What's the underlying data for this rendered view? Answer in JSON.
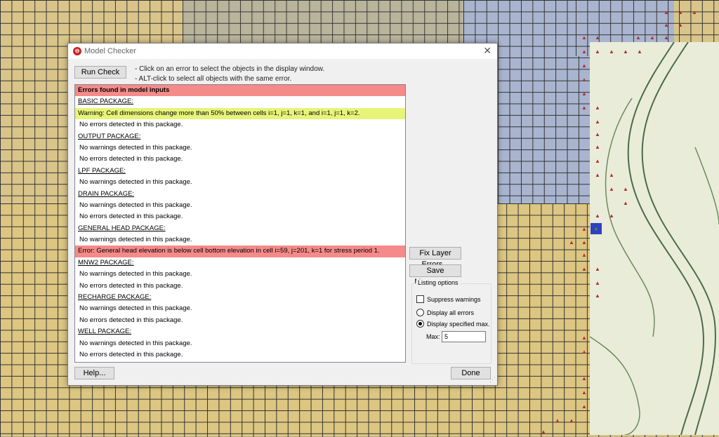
{
  "window": {
    "title": "Model Checker"
  },
  "buttons": {
    "run_check": "Run Check",
    "fix_layer_errors": "Fix Layer Errors...",
    "save_messages": "Save Messages...",
    "help": "Help...",
    "done": "Done"
  },
  "hints": [
    "- Click on an error to select the objects in the display window.",
    "- ALT-click to select all objects with the same error."
  ],
  "messages": [
    {
      "type": "header",
      "text": "Errors found in model inputs"
    },
    {
      "type": "package",
      "text": "BASIC PACKAGE:"
    },
    {
      "type": "warning",
      "text": "Warning:  Cell dimensions change more than 50% between cells i=1, j=1, k=1, and i=1, j=1, k=2."
    },
    {
      "type": "note",
      "text": "No errors detected in this package."
    },
    {
      "type": "package",
      "text": "OUTPUT PACKAGE:"
    },
    {
      "type": "note",
      "text": "No warnings detected in this package."
    },
    {
      "type": "note",
      "text": "No errors detected in this package."
    },
    {
      "type": "package",
      "text": "LPF PACKAGE:"
    },
    {
      "type": "note",
      "text": "No warnings detected in this package."
    },
    {
      "type": "package",
      "text": "DRAIN PACKAGE:"
    },
    {
      "type": "note",
      "text": "No warnings detected in this package."
    },
    {
      "type": "note",
      "text": "No errors detected in this package."
    },
    {
      "type": "package",
      "text": "GENERAL HEAD PACKAGE:"
    },
    {
      "type": "note",
      "text": "No warnings detected in this package."
    },
    {
      "type": "error",
      "text": "Error:  General head elevation is below cell bottom elevation in cell i=59, j=201, k=1 for stress period 1."
    },
    {
      "type": "package",
      "text": "MNW2 PACKAGE:"
    },
    {
      "type": "note",
      "text": "No warnings detected in this package."
    },
    {
      "type": "note",
      "text": "No errors detected in this package."
    },
    {
      "type": "package",
      "text": "RECHARGE PACKAGE:"
    },
    {
      "type": "note",
      "text": "No warnings detected in this package."
    },
    {
      "type": "note",
      "text": "No errors detected in this package."
    },
    {
      "type": "package",
      "text": "WELL PACKAGE:"
    },
    {
      "type": "note",
      "text": "No warnings detected in this package."
    },
    {
      "type": "note",
      "text": "No errors detected in this package."
    }
  ],
  "listing_options": {
    "label": "Listing options",
    "suppress_warnings": "Suppress warnings",
    "suppress_checked": false,
    "display_all": "Display all errors",
    "display_max": "Display specified max.",
    "selected": "display_max",
    "max_label": "Max:",
    "max_value": "5"
  },
  "colors": {
    "header_row": "#f58a8a",
    "warning_row": "#e6f57a",
    "error_row": "#f58a8a"
  }
}
